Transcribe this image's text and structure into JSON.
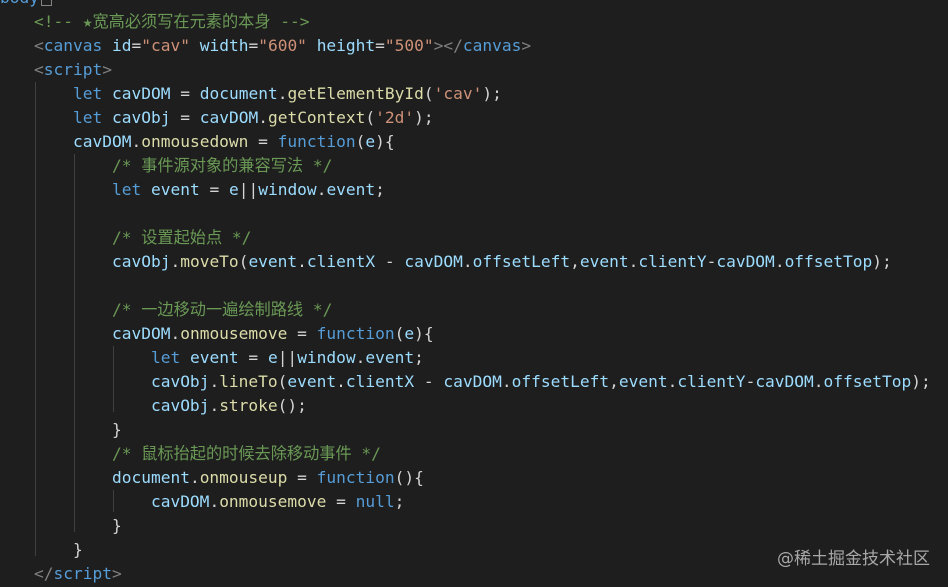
{
  "top_fragment": "body",
  "watermark": "@稀土掘金技术社区",
  "colors": {
    "background": "#1e1e1e",
    "tag": "#569cd6",
    "attribute": "#9cdcfe",
    "string": "#ce9178",
    "keyword": "#569cd6",
    "function": "#dcdcaa",
    "comment": "#6a9955",
    "text": "#d4d4d4"
  },
  "lines": [
    [
      {
        "t": "<!-- ★宽高必须写在元素的本身 -->",
        "c": "comment"
      }
    ],
    [
      {
        "t": "<",
        "c": "punc"
      },
      {
        "t": "canvas",
        "c": "tag"
      },
      {
        "t": " ",
        "c": "plain"
      },
      {
        "t": "id",
        "c": "attr"
      },
      {
        "t": "=",
        "c": "plain"
      },
      {
        "t": "\"cav\"",
        "c": "str"
      },
      {
        "t": " ",
        "c": "plain"
      },
      {
        "t": "width",
        "c": "attr"
      },
      {
        "t": "=",
        "c": "plain"
      },
      {
        "t": "\"600\"",
        "c": "str"
      },
      {
        "t": " ",
        "c": "plain"
      },
      {
        "t": "height",
        "c": "attr"
      },
      {
        "t": "=",
        "c": "plain"
      },
      {
        "t": "\"500\"",
        "c": "str"
      },
      {
        "t": "></",
        "c": "punc"
      },
      {
        "t": "canvas",
        "c": "tag"
      },
      {
        "t": ">",
        "c": "punc"
      }
    ],
    [
      {
        "t": "<",
        "c": "punc"
      },
      {
        "t": "script",
        "c": "tag"
      },
      {
        "t": ">",
        "c": "punc"
      }
    ],
    [
      {
        "t": "    ",
        "c": "plain"
      },
      {
        "t": "let",
        "c": "kw"
      },
      {
        "t": " ",
        "c": "plain"
      },
      {
        "t": "cavDOM",
        "c": "var"
      },
      {
        "t": " = ",
        "c": "plain"
      },
      {
        "t": "document",
        "c": "var"
      },
      {
        "t": ".",
        "c": "plain"
      },
      {
        "t": "getElementById",
        "c": "fn"
      },
      {
        "t": "(",
        "c": "plain"
      },
      {
        "t": "'cav'",
        "c": "str"
      },
      {
        "t": ");",
        "c": "plain"
      }
    ],
    [
      {
        "t": "    ",
        "c": "plain"
      },
      {
        "t": "let",
        "c": "kw"
      },
      {
        "t": " ",
        "c": "plain"
      },
      {
        "t": "cavObj",
        "c": "var"
      },
      {
        "t": " = ",
        "c": "plain"
      },
      {
        "t": "cavDOM",
        "c": "var"
      },
      {
        "t": ".",
        "c": "plain"
      },
      {
        "t": "getContext",
        "c": "fn"
      },
      {
        "t": "(",
        "c": "plain"
      },
      {
        "t": "'2d'",
        "c": "str"
      },
      {
        "t": ");",
        "c": "plain"
      }
    ],
    [
      {
        "t": "    ",
        "c": "plain"
      },
      {
        "t": "cavDOM",
        "c": "var"
      },
      {
        "t": ".",
        "c": "plain"
      },
      {
        "t": "onmousedown",
        "c": "fn"
      },
      {
        "t": " = ",
        "c": "plain"
      },
      {
        "t": "function",
        "c": "kw"
      },
      {
        "t": "(",
        "c": "plain"
      },
      {
        "t": "e",
        "c": "var"
      },
      {
        "t": "){",
        "c": "plain"
      }
    ],
    [
      {
        "t": "        ",
        "c": "plain"
      },
      {
        "t": "/* 事件源对象的兼容写法 */",
        "c": "comment"
      }
    ],
    [
      {
        "t": "        ",
        "c": "plain"
      },
      {
        "t": "let",
        "c": "kw"
      },
      {
        "t": " ",
        "c": "plain"
      },
      {
        "t": "event",
        "c": "var"
      },
      {
        "t": " = ",
        "c": "plain"
      },
      {
        "t": "e",
        "c": "var"
      },
      {
        "t": "||",
        "c": "plain"
      },
      {
        "t": "window",
        "c": "var"
      },
      {
        "t": ".",
        "c": "plain"
      },
      {
        "t": "event",
        "c": "var"
      },
      {
        "t": ";",
        "c": "plain"
      }
    ],
    [],
    [
      {
        "t": "        ",
        "c": "plain"
      },
      {
        "t": "/* 设置起始点 */",
        "c": "comment"
      }
    ],
    [
      {
        "t": "        ",
        "c": "plain"
      },
      {
        "t": "cavObj",
        "c": "var"
      },
      {
        "t": ".",
        "c": "plain"
      },
      {
        "t": "moveTo",
        "c": "fn"
      },
      {
        "t": "(",
        "c": "plain"
      },
      {
        "t": "event",
        "c": "var"
      },
      {
        "t": ".",
        "c": "plain"
      },
      {
        "t": "clientX",
        "c": "var"
      },
      {
        "t": " - ",
        "c": "plain"
      },
      {
        "t": "cavDOM",
        "c": "var"
      },
      {
        "t": ".",
        "c": "plain"
      },
      {
        "t": "offsetLeft",
        "c": "var"
      },
      {
        "t": ",",
        "c": "plain"
      },
      {
        "t": "event",
        "c": "var"
      },
      {
        "t": ".",
        "c": "plain"
      },
      {
        "t": "clientY",
        "c": "var"
      },
      {
        "t": "-",
        "c": "plain"
      },
      {
        "t": "cavDOM",
        "c": "var"
      },
      {
        "t": ".",
        "c": "plain"
      },
      {
        "t": "offsetTop",
        "c": "var"
      },
      {
        "t": ");",
        "c": "plain"
      }
    ],
    [],
    [
      {
        "t": "        ",
        "c": "plain"
      },
      {
        "t": "/* 一边移动一遍绘制路线 */",
        "c": "comment"
      }
    ],
    [
      {
        "t": "        ",
        "c": "plain"
      },
      {
        "t": "cavDOM",
        "c": "var"
      },
      {
        "t": ".",
        "c": "plain"
      },
      {
        "t": "onmousemove",
        "c": "fn"
      },
      {
        "t": " = ",
        "c": "plain"
      },
      {
        "t": "function",
        "c": "kw"
      },
      {
        "t": "(",
        "c": "plain"
      },
      {
        "t": "e",
        "c": "var"
      },
      {
        "t": "){",
        "c": "plain"
      }
    ],
    [
      {
        "t": "            ",
        "c": "plain"
      },
      {
        "t": "let",
        "c": "kw"
      },
      {
        "t": " ",
        "c": "plain"
      },
      {
        "t": "event",
        "c": "var"
      },
      {
        "t": " = ",
        "c": "plain"
      },
      {
        "t": "e",
        "c": "var"
      },
      {
        "t": "||",
        "c": "plain"
      },
      {
        "t": "window",
        "c": "var"
      },
      {
        "t": ".",
        "c": "plain"
      },
      {
        "t": "event",
        "c": "var"
      },
      {
        "t": ";",
        "c": "plain"
      }
    ],
    [
      {
        "t": "            ",
        "c": "plain"
      },
      {
        "t": "cavObj",
        "c": "var"
      },
      {
        "t": ".",
        "c": "plain"
      },
      {
        "t": "lineTo",
        "c": "fn"
      },
      {
        "t": "(",
        "c": "plain"
      },
      {
        "t": "event",
        "c": "var"
      },
      {
        "t": ".",
        "c": "plain"
      },
      {
        "t": "clientX",
        "c": "var"
      },
      {
        "t": " - ",
        "c": "plain"
      },
      {
        "t": "cavDOM",
        "c": "var"
      },
      {
        "t": ".",
        "c": "plain"
      },
      {
        "t": "offsetLeft",
        "c": "var"
      },
      {
        "t": ",",
        "c": "plain"
      },
      {
        "t": "event",
        "c": "var"
      },
      {
        "t": ".",
        "c": "plain"
      },
      {
        "t": "clientY",
        "c": "var"
      },
      {
        "t": "-",
        "c": "plain"
      },
      {
        "t": "cavDOM",
        "c": "var"
      },
      {
        "t": ".",
        "c": "plain"
      },
      {
        "t": "offsetTop",
        "c": "var"
      },
      {
        "t": ");",
        "c": "plain"
      }
    ],
    [
      {
        "t": "            ",
        "c": "plain"
      },
      {
        "t": "cavObj",
        "c": "var"
      },
      {
        "t": ".",
        "c": "plain"
      },
      {
        "t": "stroke",
        "c": "fn"
      },
      {
        "t": "();",
        "c": "plain"
      }
    ],
    [
      {
        "t": "        }",
        "c": "plain"
      }
    ],
    [
      {
        "t": "        ",
        "c": "plain"
      },
      {
        "t": "/* 鼠标抬起的时候去除移动事件 */",
        "c": "comment"
      }
    ],
    [
      {
        "t": "        ",
        "c": "plain"
      },
      {
        "t": "document",
        "c": "var"
      },
      {
        "t": ".",
        "c": "plain"
      },
      {
        "t": "onmouseup",
        "c": "fn"
      },
      {
        "t": " = ",
        "c": "plain"
      },
      {
        "t": "function",
        "c": "kw"
      },
      {
        "t": "(){",
        "c": "plain"
      }
    ],
    [
      {
        "t": "            ",
        "c": "plain"
      },
      {
        "t": "cavDOM",
        "c": "var"
      },
      {
        "t": ".",
        "c": "plain"
      },
      {
        "t": "onmousemove",
        "c": "fn"
      },
      {
        "t": " = ",
        "c": "plain"
      },
      {
        "t": "null",
        "c": "kw"
      },
      {
        "t": ";",
        "c": "plain"
      }
    ],
    [
      {
        "t": "        }",
        "c": "plain"
      }
    ],
    [
      {
        "t": "    }",
        "c": "plain"
      }
    ],
    [
      {
        "t": "</",
        "c": "punc"
      },
      {
        "t": "script",
        "c": "tag"
      },
      {
        "t": ">",
        "c": "punc"
      }
    ]
  ]
}
